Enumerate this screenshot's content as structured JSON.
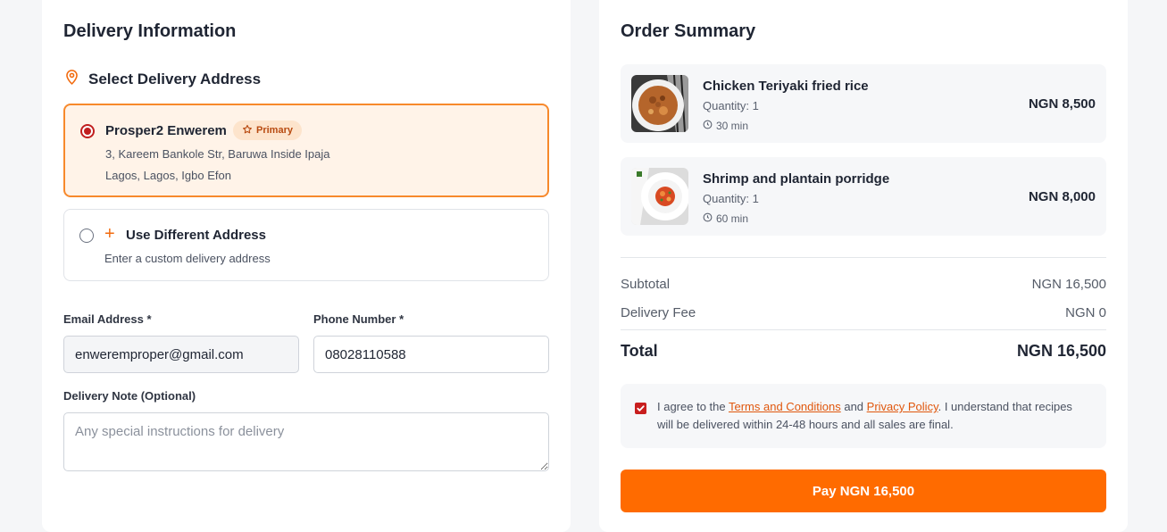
{
  "delivery": {
    "title": "Delivery Information",
    "address_heading": "Select Delivery Address",
    "primary_address": {
      "name": "Prosper2 Enwerem",
      "badge": "Primary",
      "line1": "3, Kareem Bankole Str, Baruwa Inside Ipaja",
      "line2": "Lagos, Lagos, Igbo Efon",
      "selected": true
    },
    "different_address": {
      "plus": "+",
      "title": "Use Different Address",
      "subtitle": "Enter a custom delivery address",
      "selected": false
    },
    "email": {
      "label": "Email Address *",
      "value": "enweremproper@gmail.com"
    },
    "phone": {
      "label": "Phone Number *",
      "value": "08028110588"
    },
    "note": {
      "label": "Delivery Note (Optional)",
      "placeholder": "Any special instructions for delivery"
    }
  },
  "summary": {
    "title": "Order Summary",
    "items": [
      {
        "name": "Chicken Teriyaki fried rice",
        "quantity": "Quantity: 1",
        "time": "30 min",
        "price": "NGN 8,500"
      },
      {
        "name": "Shrimp and plantain porridge",
        "quantity": "Quantity: 1",
        "time": "60 min",
        "price": "NGN 8,000"
      }
    ],
    "subtotal_label": "Subtotal",
    "subtotal_value": "NGN 16,500",
    "delivery_fee_label": "Delivery Fee",
    "delivery_fee_value": "NGN 0",
    "total_label": "Total",
    "total_value": "NGN 16,500",
    "terms": {
      "prefix": "I agree to the ",
      "terms_link": "Terms and Conditions",
      "and": " and ",
      "privacy_link": "Privacy Policy",
      "suffix": ". I understand that recipes will be delivered within 24-48 hours and all sales are final.",
      "checked": true
    },
    "pay_button": "Pay NGN 16,500"
  },
  "colors": {
    "accent": "#ff6b00",
    "primary_card_bg": "#fff3e8",
    "primary_card_border": "#f7892c",
    "checkbox": "#c81e1e",
    "link": "#e0570d"
  }
}
